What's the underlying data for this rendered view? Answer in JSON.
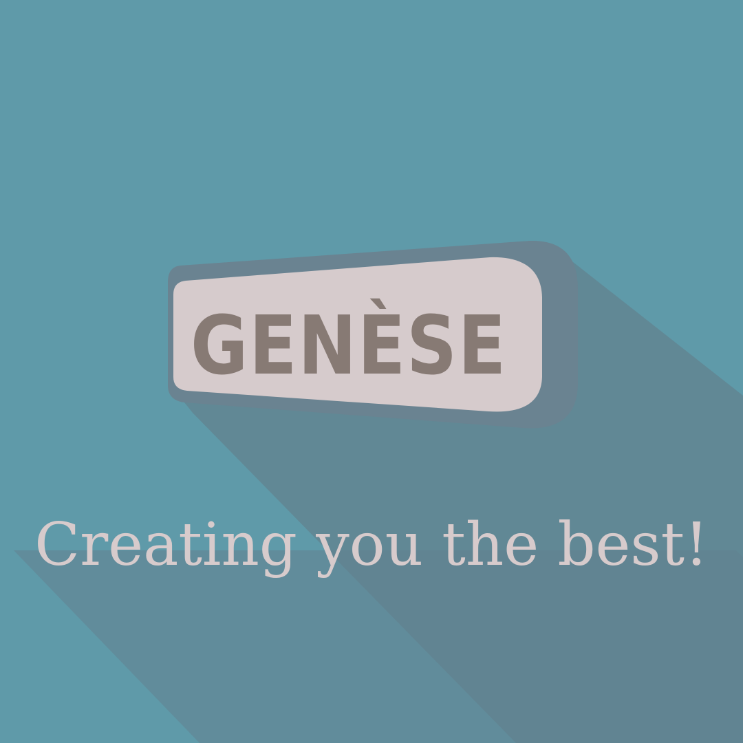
{
  "logo": {
    "text": "GENÈSE"
  },
  "tagline": {
    "text": "Creating you the best!"
  },
  "colors": {
    "background": "#5f9aa9",
    "long_shadow": "#62828f",
    "badge_face": "#d6cbcc",
    "badge_rim": "#6a8391",
    "logo_text": "#877a74",
    "tagline_text": "#d7cbcc"
  }
}
